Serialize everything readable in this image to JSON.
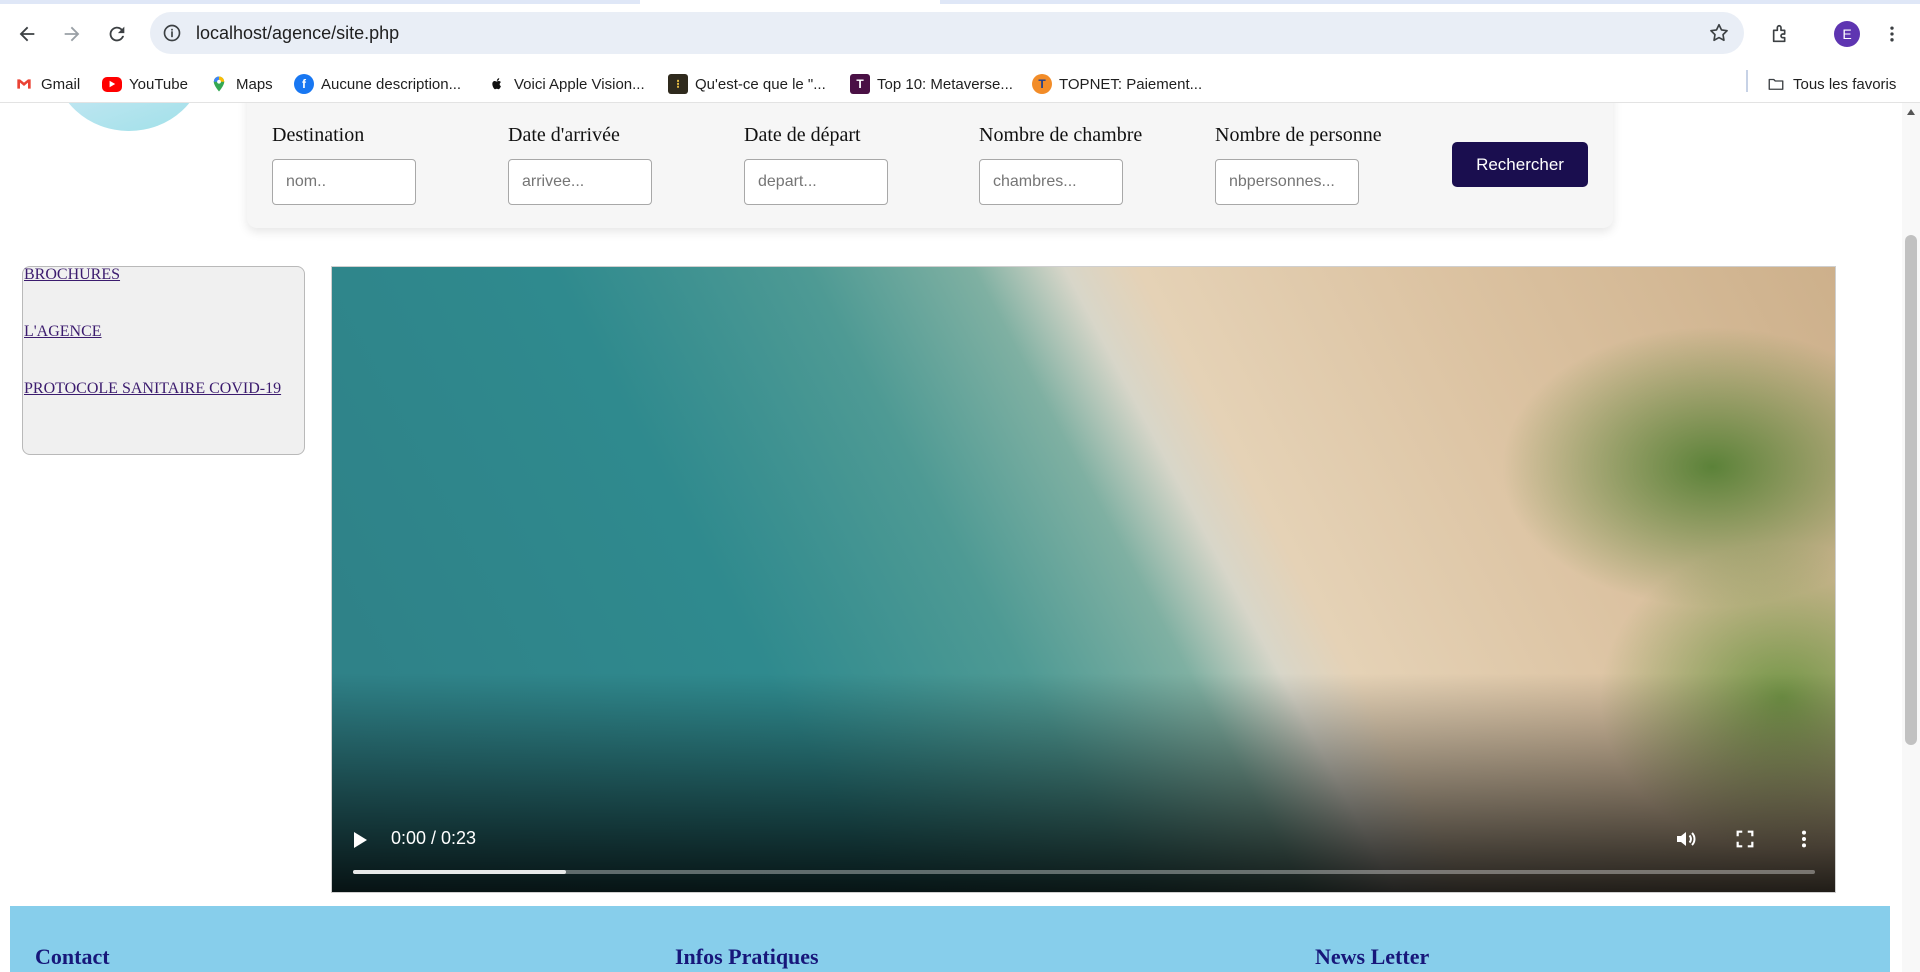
{
  "browser": {
    "url": "localhost/agence/site.php",
    "profile_initial": "E"
  },
  "bookmarks": [
    {
      "label": "Gmail",
      "icon": "gmail-icon"
    },
    {
      "label": "YouTube",
      "icon": "youtube-icon"
    },
    {
      "label": "Maps",
      "icon": "maps-icon"
    },
    {
      "label": "Aucune description...",
      "icon": "facebook-icon"
    },
    {
      "label": "Voici Apple Vision...",
      "icon": "apple-icon"
    },
    {
      "label": "Qu'est-ce que le \"...",
      "icon": "site-icon"
    },
    {
      "label": "Top 10: Metaverse...",
      "icon": "t-icon"
    },
    {
      "label": "TOPNET: Paiement...",
      "icon": "topnet-icon"
    }
  ],
  "all_bookmarks_label": "Tous les favoris",
  "search_form": {
    "fields": [
      {
        "label": "Destination",
        "placeholder": "nom.."
      },
      {
        "label": "Date d'arrivée",
        "placeholder": "arrivee..."
      },
      {
        "label": "Date de départ",
        "placeholder": "depart..."
      },
      {
        "label": "Nombre de chambre",
        "placeholder": "chambres..."
      },
      {
        "label": "Nombre de personne",
        "placeholder": "nbpersonnes..."
      }
    ],
    "submit_label": "Rechercher",
    "submit_color": "#1a0e4f"
  },
  "sidebar": {
    "links": [
      "BROCHURES",
      "L'AGENCE",
      "PROTOCOLE SANITAIRE COVID-19"
    ],
    "link_color": "#3b1b6e"
  },
  "video": {
    "time": "0:00 / 0:23",
    "buffered_fraction": 0.146
  },
  "footer": {
    "background": "#87ceeb",
    "headings": [
      "Contact",
      "Infos Pratiques",
      "News Letter"
    ]
  }
}
